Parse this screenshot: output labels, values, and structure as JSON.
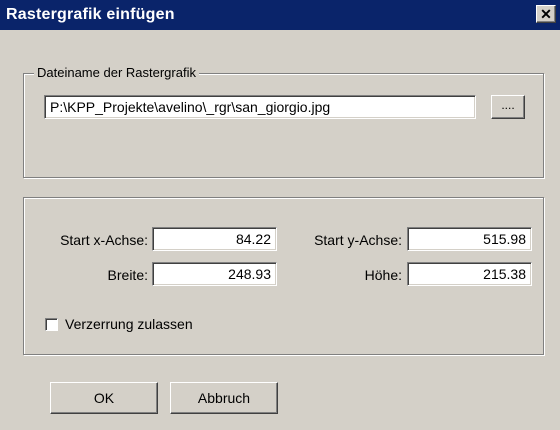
{
  "window": {
    "title": "Rastergrafik einfügen",
    "close_symbol": "✕"
  },
  "file_group": {
    "label": "Dateiname der Rastergrafik",
    "path": "P:\\KPP_Projekte\\avelino\\_rgr\\san_giorgio.jpg",
    "browse_label": "...."
  },
  "params": {
    "start_x_label": "Start x-Achse:",
    "start_x_value": "84.22",
    "start_y_label": "Start y-Achse:",
    "start_y_value": "515.98",
    "width_label": "Breite:",
    "width_value": "248.93",
    "height_label": "Höhe:",
    "height_value": "215.38",
    "distortion_label": "Verzerrung zulassen",
    "distortion_checked": false
  },
  "buttons": {
    "ok": "OK",
    "cancel": "Abbruch"
  }
}
